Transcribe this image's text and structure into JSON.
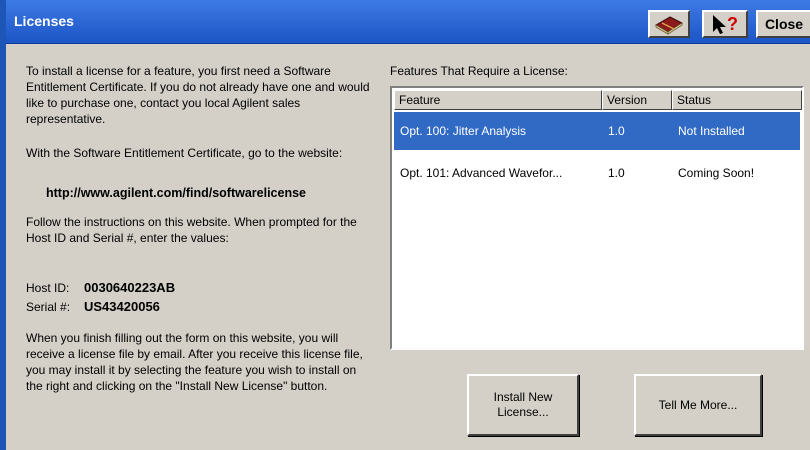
{
  "window": {
    "title": "Licenses",
    "close_label": "Close"
  },
  "icons": {
    "book": "book-icon",
    "help": "help-pointer-icon"
  },
  "left_panel": {
    "intro": "To install a license for a feature, you first need a Software Entitlement Certificate.  If you do not already have one and would like to purchase one, contact you local Agilent sales representative.",
    "with_certificate": "With the Software Entitlement Certificate, go to the website:",
    "url": "http://www.agilent.com/find/softwarelicense",
    "follow": "Follow the instructions on this website.  When prompted for the Host ID and Serial #, enter the values:",
    "host_id_label": "Host ID:",
    "host_id_value": "0030640223AB",
    "serial_label": "Serial #:",
    "serial_value": "US43420056",
    "finish": "When you finish filling out the form on this website, you will receive a license file by email.  After you receive this license file, you may install it by selecting the feature you wish to install on the right and clicking on the \"Install New License\" button."
  },
  "features": {
    "heading": "Features That Require a License:",
    "columns": [
      "Feature",
      "Version",
      "Status"
    ],
    "rows": [
      {
        "feature": "Opt. 100: Jitter Analysis",
        "version": "1.0",
        "status": "Not Installed",
        "selected": true
      },
      {
        "feature": "Opt. 101: Advanced Wavefor...",
        "version": "1.0",
        "status": "Coming Soon!",
        "selected": false
      }
    ]
  },
  "buttons": {
    "install_new_license": "Install New\nLicense...",
    "tell_me_more": "Tell Me More..."
  }
}
